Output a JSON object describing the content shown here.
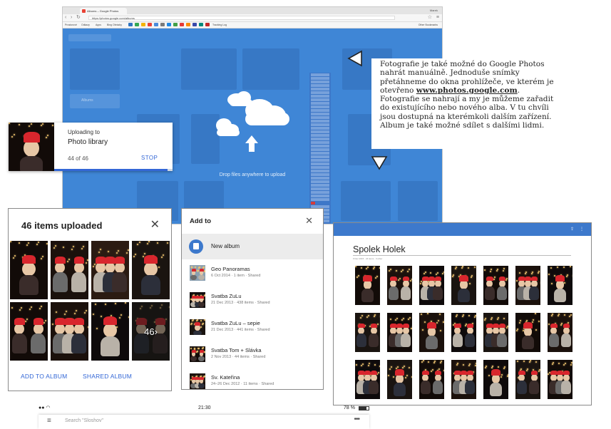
{
  "browser": {
    "tab_title": "Albums – Google Photos",
    "window_user": "Marek",
    "url": "https://photos.google.com/albums",
    "drop_text": "Drop files anywhere to upload",
    "ghost_label": "Albums",
    "bookmarks": [
      "Prostorové",
      "Odkazy",
      "Apps",
      "Bing Obrázky",
      "Tracking Log",
      "Other Bookmarks"
    ]
  },
  "upload_card": {
    "title": "Uploading to",
    "destination": "Photo library",
    "count": "44 of 46",
    "stop_label": "STOP",
    "progress_fraction": 0.957
  },
  "items_dialog": {
    "title": "46 items uploaded",
    "more_count": "46",
    "add_to_album_label": "ADD TO ALBUM",
    "shared_album_label": "SHARED ALBUM"
  },
  "addto_dialog": {
    "title": "Add to",
    "new_album_label": "New album",
    "albums": [
      {
        "name": "Geo Panoramas",
        "date": "6 Oct 2014",
        "items": "1 item",
        "status": "Shared"
      },
      {
        "name": "Svatba ZuLu",
        "date": "21 Dec 2013",
        "items": "438 items",
        "status": "Shared"
      },
      {
        "name": "Svatba ZuLu – sepie",
        "date": "21 Dec 2013",
        "items": "441 items",
        "status": "Shared"
      },
      {
        "name": "Svatba Tom + Slávka",
        "date": "2 Nov 2013",
        "items": "44 items",
        "status": "Shared"
      },
      {
        "name": "Sv. Kateřina",
        "date": "24–26 Dec 2012",
        "items": "11 items",
        "status": "Shared"
      }
    ]
  },
  "spolek_page": {
    "title": "Spolek Holek",
    "subtitle": "9 Dec 2015 · 24 items · 3 other"
  },
  "description": {
    "text_before_link": "Fotografie je také možné do Google Photos nahrát manuálně. Jednoduše snímky přetáhneme do okna prohlížeče, ve kterém je otevřeno ",
    "link": "www.photos.google.com",
    "text_after_link": ". Fotografie se nahrají a my je můžeme zařadit do existujícího nebo nového alba. V tu chvíli jsou dostupná na kterémkoli dalším zařízení. Album je také možné sdílet s dalšími lidmi."
  },
  "phone": {
    "time": "21:30",
    "battery": "78 %",
    "battery_fraction": 0.78,
    "search_placeholder": "Search \"Sloshov\""
  },
  "colors": {
    "accent": "#3367d6",
    "overlay_blue": "#3f86d6",
    "album_icon": "#3d79cc",
    "hat_red": "#d8262d"
  },
  "icons": {
    "close": "close-icon",
    "menu": "hamburger-menu-icon",
    "more": "more-dots-icon",
    "upload": "upload-arrow-icon",
    "cloud": "cloud-icon",
    "album": "photo-album-icon"
  }
}
